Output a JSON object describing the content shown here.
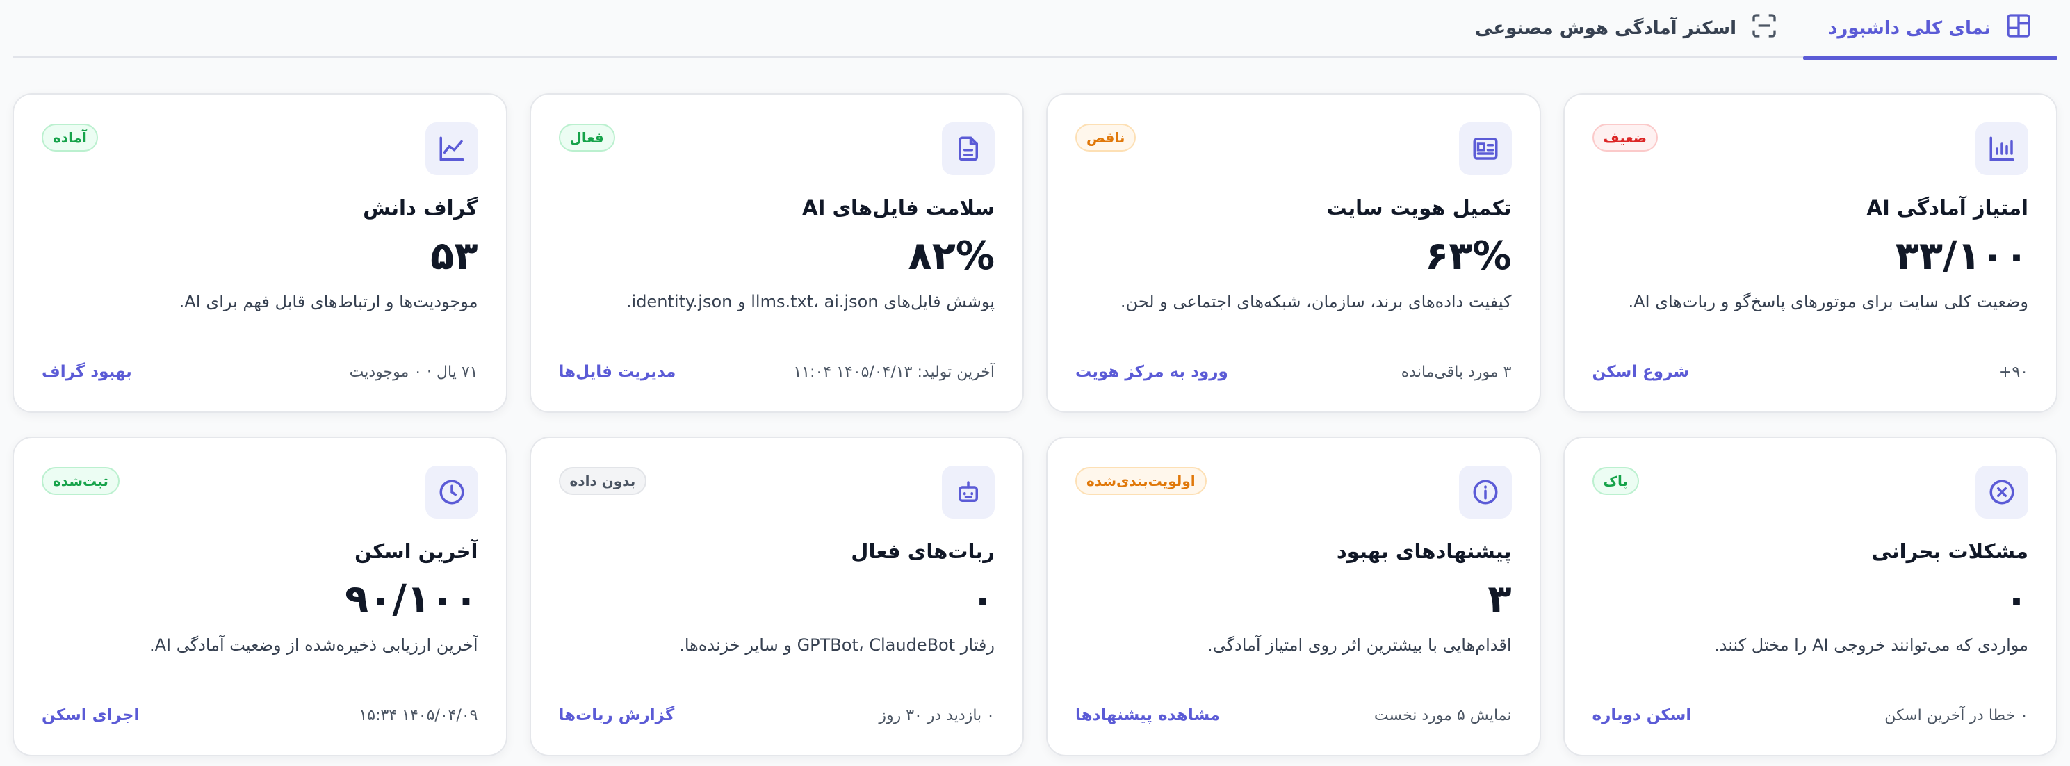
{
  "tabs": [
    {
      "label": "نمای کلی داشبورد",
      "icon": "dashboard-icon",
      "active": true
    },
    {
      "label": "اسکنر آمادگی هوش مصنوعی",
      "icon": "scan-icon",
      "active": false
    }
  ],
  "colors": {
    "accent": "#5b5bd6",
    "icon_bg": "#eef0fb"
  },
  "cards": [
    {
      "icon": "bar-chart-icon",
      "badge": "ضعیف",
      "badge_tone": "red",
      "title": "امتیاز آمادگی AI",
      "value": "۳۳/۱۰۰",
      "desc": "وضعیت کلی سایت برای موتورهای پاسخ‌گو و ربات‌های AI.",
      "meta": "۹۰+",
      "link": "شروع اسکن"
    },
    {
      "icon": "id-card-icon",
      "badge": "ناقص",
      "badge_tone": "orange",
      "title": "تکمیل هویت سایت",
      "value": "۶۳%",
      "desc": "کیفیت داده‌های برند، سازمان، شبکه‌های اجتماعی و لحن.",
      "meta": "۳ مورد باقی‌مانده",
      "link": "ورود به مرکز هویت"
    },
    {
      "icon": "file-icon",
      "badge": "فعال",
      "badge_tone": "green",
      "title": "سلامت فایل‌های AI",
      "value": "۸۲%",
      "desc": "پوشش فایل‌های llms.txt، ai.json و identity.json.",
      "meta": "آخرین تولید: ۱۴۰۵/۰۴/۱۳ ۱۱:۰۴",
      "link": "مدیریت فایل‌ها"
    },
    {
      "icon": "trend-chart-icon",
      "badge": "آماده",
      "badge_tone": "green",
      "title": "گراف دانش",
      "value": "۵۳",
      "desc": "موجودیت‌ها و ارتباط‌های قابل فهم برای AI.",
      "meta": "۷۱ یال · ۰ موجودیت",
      "link": "بهبود گراف"
    },
    {
      "icon": "x-circle-icon",
      "badge": "پاک",
      "badge_tone": "green",
      "title": "مشکلات بحرانی",
      "value": "۰",
      "desc": "مواردی که می‌توانند خروجی AI را مختل کنند.",
      "meta": "۰ خطا در آخرین اسکن",
      "link": "اسکن دوباره"
    },
    {
      "icon": "info-icon",
      "badge": "اولویت‌بندی‌شده",
      "badge_tone": "orange",
      "title": "پیشنهادهای بهبود",
      "value": "۳",
      "desc": "اقدام‌هایی با بیشترین اثر روی امتیاز آمادگی.",
      "meta": "نمایش ۵ مورد نخست",
      "link": "مشاهده پیشنهادها"
    },
    {
      "icon": "robot-icon",
      "badge": "بدون داده",
      "badge_tone": "gray",
      "title": "ربات‌های فعال",
      "value": "۰",
      "desc": "رفتار GPTBot، ClaudeBot و سایر خزنده‌ها.",
      "meta": "۰ بازدید در ۳۰ روز",
      "link": "گزارش ربات‌ها"
    },
    {
      "icon": "clock-icon",
      "badge": "ثبت‌شده",
      "badge_tone": "green",
      "title": "آخرین اسکن",
      "value": "۹۰/۱۰۰",
      "desc": "آخرین ارزیابی ذخیره‌شده از وضعیت آمادگی AI.",
      "meta": "۱۴۰۵/۰۴/۰۹ ۱۵:۳۴",
      "link": "اجرای اسکن"
    }
  ]
}
